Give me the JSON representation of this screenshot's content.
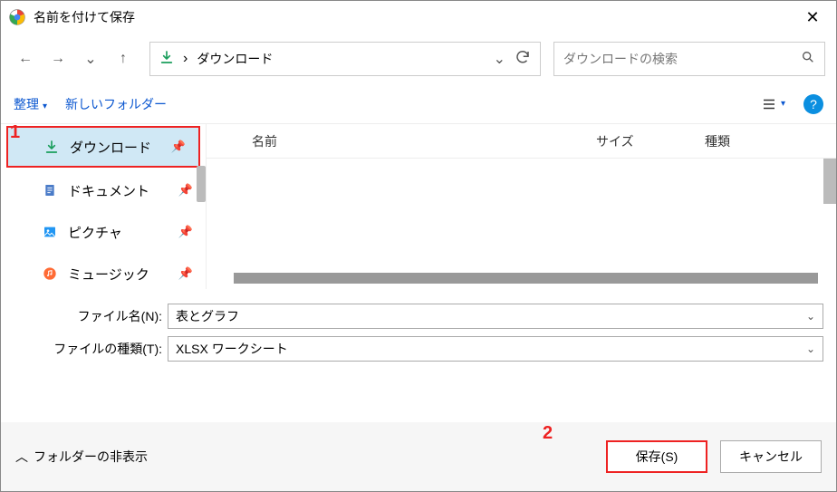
{
  "title": "名前を付けて保存",
  "path": {
    "crumb": "ダウンロード"
  },
  "search": {
    "placeholder": "ダウンロードの検索"
  },
  "toolbar": {
    "organize": "整理",
    "newfolder": "新しいフォルダー"
  },
  "sidebar": {
    "items": [
      {
        "label": "ダウンロード"
      },
      {
        "label": "ドキュメント"
      },
      {
        "label": "ピクチャ"
      },
      {
        "label": "ミュージック"
      }
    ]
  },
  "columns": {
    "name": "名前",
    "size": "サイズ",
    "type": "種類"
  },
  "fields": {
    "filename_label": "ファイル名(N):",
    "filename_value": "表とグラフ",
    "filetype_label": "ファイルの種類(T):",
    "filetype_value": "XLSX ワークシート"
  },
  "footer": {
    "hide": "フォルダーの非表示",
    "save": "保存(S)",
    "cancel": "キャンセル"
  },
  "markers": {
    "one": "1",
    "two": "2"
  }
}
